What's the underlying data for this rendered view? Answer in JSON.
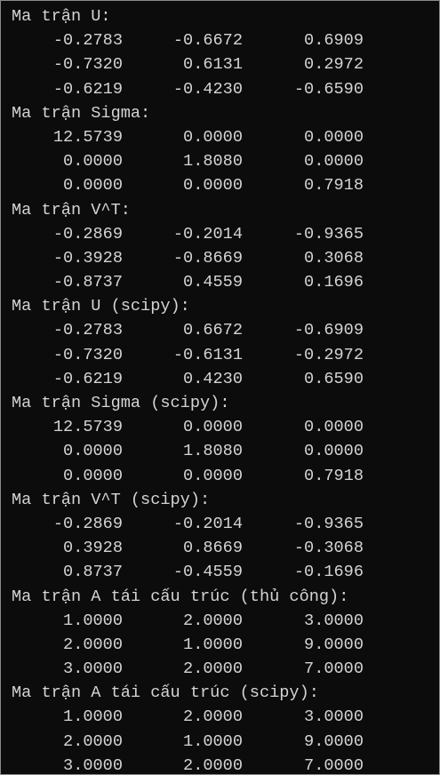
{
  "sections": [
    {
      "title": "Ma trận U:",
      "rows": [
        [
          "-0.2783",
          "-0.6672",
          "0.6909"
        ],
        [
          "-0.7320",
          "0.6131",
          "0.2972"
        ],
        [
          "-0.6219",
          "-0.4230",
          "-0.6590"
        ]
      ]
    },
    {
      "title": "Ma trận Sigma:",
      "rows": [
        [
          "12.5739",
          "0.0000",
          "0.0000"
        ],
        [
          "0.0000",
          "1.8080",
          "0.0000"
        ],
        [
          "0.0000",
          "0.0000",
          "0.7918"
        ]
      ]
    },
    {
      "title": "Ma trận V^T:",
      "rows": [
        [
          "-0.2869",
          "-0.2014",
          "-0.9365"
        ],
        [
          "-0.3928",
          "-0.8669",
          "0.3068"
        ],
        [
          "-0.8737",
          "0.4559",
          "0.1696"
        ]
      ]
    },
    {
      "title": "Ma trận U (scipy):",
      "rows": [
        [
          "-0.2783",
          "0.6672",
          "-0.6909"
        ],
        [
          "-0.7320",
          "-0.6131",
          "-0.2972"
        ],
        [
          "-0.6219",
          "0.4230",
          "0.6590"
        ]
      ]
    },
    {
      "title": "Ma trận Sigma (scipy):",
      "rows": [
        [
          "12.5739",
          "0.0000",
          "0.0000"
        ],
        [
          "0.0000",
          "1.8080",
          "0.0000"
        ],
        [
          "0.0000",
          "0.0000",
          "0.7918"
        ]
      ]
    },
    {
      "title": "Ma trận V^T (scipy):",
      "rows": [
        [
          "-0.2869",
          "-0.2014",
          "-0.9365"
        ],
        [
          "0.3928",
          "0.8669",
          "-0.3068"
        ],
        [
          "0.8737",
          "-0.4559",
          "-0.1696"
        ]
      ]
    },
    {
      "title": "Ma trận A tái cấu trúc (thủ công):",
      "rows": [
        [
          "1.0000",
          "2.0000",
          "3.0000"
        ],
        [
          "2.0000",
          "1.0000",
          "9.0000"
        ],
        [
          "3.0000",
          "2.0000",
          "7.0000"
        ]
      ]
    },
    {
      "title": "Ma trận A tái cấu trúc (scipy):",
      "rows": [
        [
          "1.0000",
          "2.0000",
          "3.0000"
        ],
        [
          "2.0000",
          "1.0000",
          "9.0000"
        ],
        [
          "3.0000",
          "2.0000",
          "7.0000"
        ]
      ]
    }
  ],
  "colors": {
    "background": "#0c0c0c",
    "text": "#d4d4d4",
    "border": "#8a8a8a"
  }
}
